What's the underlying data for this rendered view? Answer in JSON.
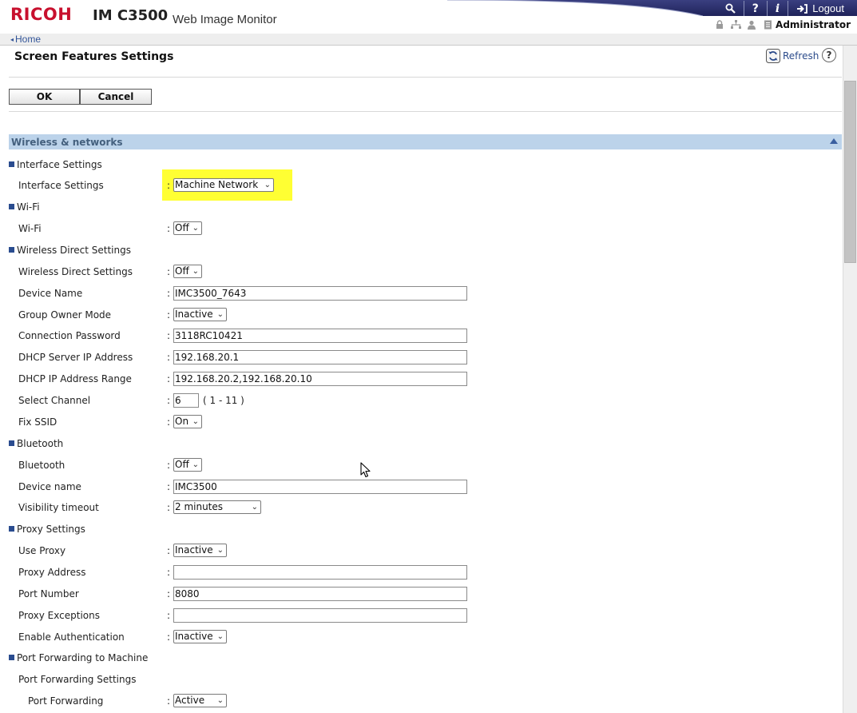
{
  "header": {
    "brand": "RICOH",
    "model": "IM C3500",
    "app_name": "Web Image Monitor",
    "logout_label": "Logout",
    "user": "Administrator",
    "nav_icons": [
      "search-icon",
      "help-icon",
      "info-icon",
      "logout-icon"
    ],
    "status_icons": [
      "lock-icon",
      "network-icon",
      "user-icon",
      "document-icon"
    ]
  },
  "breadcrumb": {
    "home": "Home"
  },
  "page": {
    "title": "Screen Features Settings",
    "refresh_label": "Refresh",
    "help_glyph": "?",
    "ok_label": "OK",
    "cancel_label": "Cancel"
  },
  "section": {
    "title": "Wireless & networks"
  },
  "groups": {
    "interface": "Interface Settings",
    "wifi": "Wi-Fi",
    "wireless_direct": "Wireless Direct Settings",
    "bluetooth": "Bluetooth",
    "proxy": "Proxy Settings",
    "port_forwarding": "Port Forwarding to Machine"
  },
  "fields": {
    "interface_settings": {
      "label": "Interface Settings",
      "value": "Machine Network"
    },
    "wifi": {
      "label": "Wi-Fi",
      "value": "Off"
    },
    "wireless_direct": {
      "label": "Wireless Direct Settings",
      "value": "Off"
    },
    "device_name": {
      "label": "Device Name",
      "value": "IMC3500_7643"
    },
    "group_owner_mode": {
      "label": "Group Owner Mode",
      "value": "Inactive"
    },
    "connection_password": {
      "label": "Connection Password",
      "value": "3118RC10421"
    },
    "dhcp_server_ip": {
      "label": "DHCP Server IP Address",
      "value": "192.168.20.1"
    },
    "dhcp_ip_range": {
      "label": "DHCP IP Address Range",
      "value": "192.168.20.2,192.168.20.10"
    },
    "select_channel": {
      "label": "Select Channel",
      "value": "6",
      "range": "( 1 - 11 )"
    },
    "fix_ssid": {
      "label": "Fix SSID",
      "value": "On"
    },
    "bluetooth": {
      "label": "Bluetooth",
      "value": "Off"
    },
    "bt_device_name": {
      "label": "Device name",
      "value": "IMC3500"
    },
    "visibility_timeout": {
      "label": "Visibility timeout",
      "value": "2 minutes"
    },
    "use_proxy": {
      "label": "Use Proxy",
      "value": "Inactive"
    },
    "proxy_address": {
      "label": "Proxy Address",
      "value": ""
    },
    "port_number": {
      "label": "Port Number",
      "value": "8080"
    },
    "proxy_exceptions": {
      "label": "Proxy Exceptions",
      "value": ""
    },
    "enable_auth": {
      "label": "Enable Authentication",
      "value": "Inactive"
    },
    "port_forwarding_settings": {
      "label": "Port Forwarding Settings"
    },
    "port_forwarding": {
      "label": "Port Forwarding",
      "value": "Active"
    }
  },
  "colors": {
    "brand_red": "#c8102e",
    "header_navy": "#2b2f6b",
    "section_bar": "#bcd3ea",
    "highlight": "#ffff33"
  }
}
